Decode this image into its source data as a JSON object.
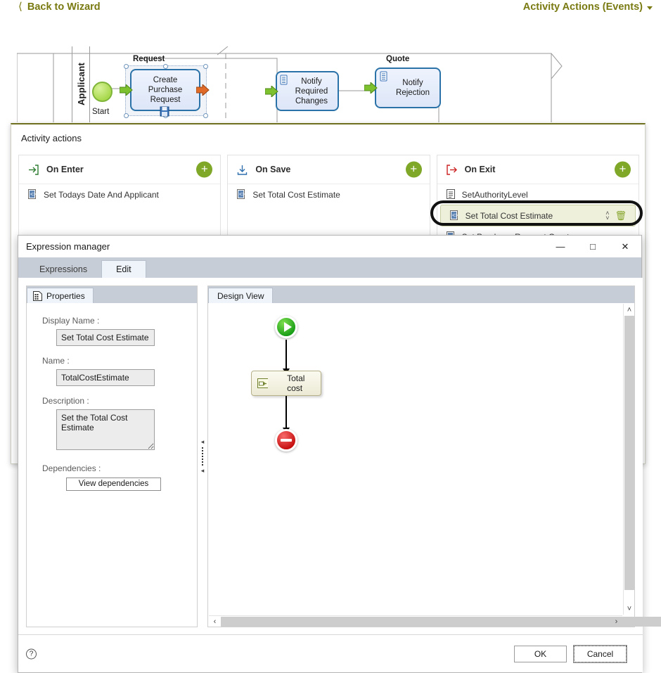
{
  "topbar": {
    "back_label": "Back to Wizard",
    "back_icon": "chevron-left-icon",
    "menu_label": "Activity Actions (Events)",
    "menu_icon": "caret-down-icon",
    "link_color": "#7a7a12"
  },
  "diagram": {
    "lane_label": "Applicant",
    "start_label": "Start",
    "group_labels": [
      "Request",
      "Quote"
    ],
    "tasks": [
      {
        "label": "Create\nPurchase\nRequest",
        "selected": true
      },
      {
        "label": "Notify\nRequired\nChanges",
        "selected": false
      },
      {
        "label": "Notify\nRejection",
        "selected": false
      }
    ],
    "task1_line1": "Create",
    "task1_line2": "Purchase",
    "task1_line3": "Request",
    "task2_line1": "Notify",
    "task2_line2": "Required",
    "task2_line3": "Changes",
    "task3_line1": "Notify",
    "task3_line2": "Rejection",
    "group1": "Request",
    "group2": "Quote"
  },
  "activity_actions": {
    "title": "Activity actions",
    "add_label": "+",
    "columns": [
      {
        "title": "On Enter",
        "icon": "enter-arrow-icon",
        "items": [
          {
            "label": "Set Todays Date And Applicant",
            "icon": "expression-icon",
            "selected": false
          }
        ]
      },
      {
        "title": "On Save",
        "icon": "save-download-icon",
        "items": [
          {
            "label": "Set Total Cost Estimate",
            "icon": "expression-icon",
            "selected": false
          }
        ]
      },
      {
        "title": "On Exit",
        "icon": "exit-arrow-icon",
        "items": [
          {
            "label": "SetAuthorityLevel",
            "icon": "script-icon",
            "selected": false
          },
          {
            "label": "Set Total Cost Estimate",
            "icon": "expression-icon",
            "selected": true
          },
          {
            "label": "Set Purchase Request Creator",
            "icon": "expression-icon",
            "selected": false
          }
        ]
      }
    ],
    "selected_row_controls": {
      "move_up": "˄",
      "move_down": "˅",
      "delete_icon": "trash-icon"
    }
  },
  "dialog": {
    "title": "Expression manager",
    "window_buttons": {
      "minimize": "—",
      "maximize": "□",
      "close": "✕"
    },
    "tabs": [
      {
        "label": "Expressions",
        "active": false
      },
      {
        "label": "Edit",
        "active": true
      }
    ],
    "properties": {
      "tab_label": "Properties",
      "tab_icon": "properties-grid-icon",
      "fields": [
        {
          "label": "Display Name :",
          "value": "Set Total Cost Estimate"
        },
        {
          "label": "Name :",
          "value": "TotalCostEstimate"
        },
        {
          "label": "Description :",
          "value": "Set the Total Cost Estimate"
        }
      ],
      "display_name_label": "Display Name :",
      "display_name_value": "Set Total Cost Estimate",
      "name_label": "Name :",
      "name_value": "TotalCostEstimate",
      "description_label": "Description :",
      "description_value": "Set the Total Cost Estimate",
      "dependencies_label": "Dependencies :",
      "view_dependencies_button": "View dependencies"
    },
    "design_view": {
      "tab_label": "Design View",
      "nodes": [
        {
          "id": "start",
          "type": "start",
          "label": "",
          "icon": "play-start-icon"
        },
        {
          "id": "totalcost",
          "type": "activity",
          "label": "Total cost",
          "icon": "assign-variable-icon"
        },
        {
          "id": "end",
          "type": "end",
          "label": "",
          "icon": "stop-end-icon"
        }
      ],
      "task_label": "Total cost",
      "scroll": {
        "up": "˄",
        "down": "˅",
        "left": "‹",
        "right": "›"
      }
    },
    "footer": {
      "help_icon": "help-question-icon",
      "help_label": "?",
      "ok_label": "OK",
      "cancel_label": "Cancel"
    }
  }
}
